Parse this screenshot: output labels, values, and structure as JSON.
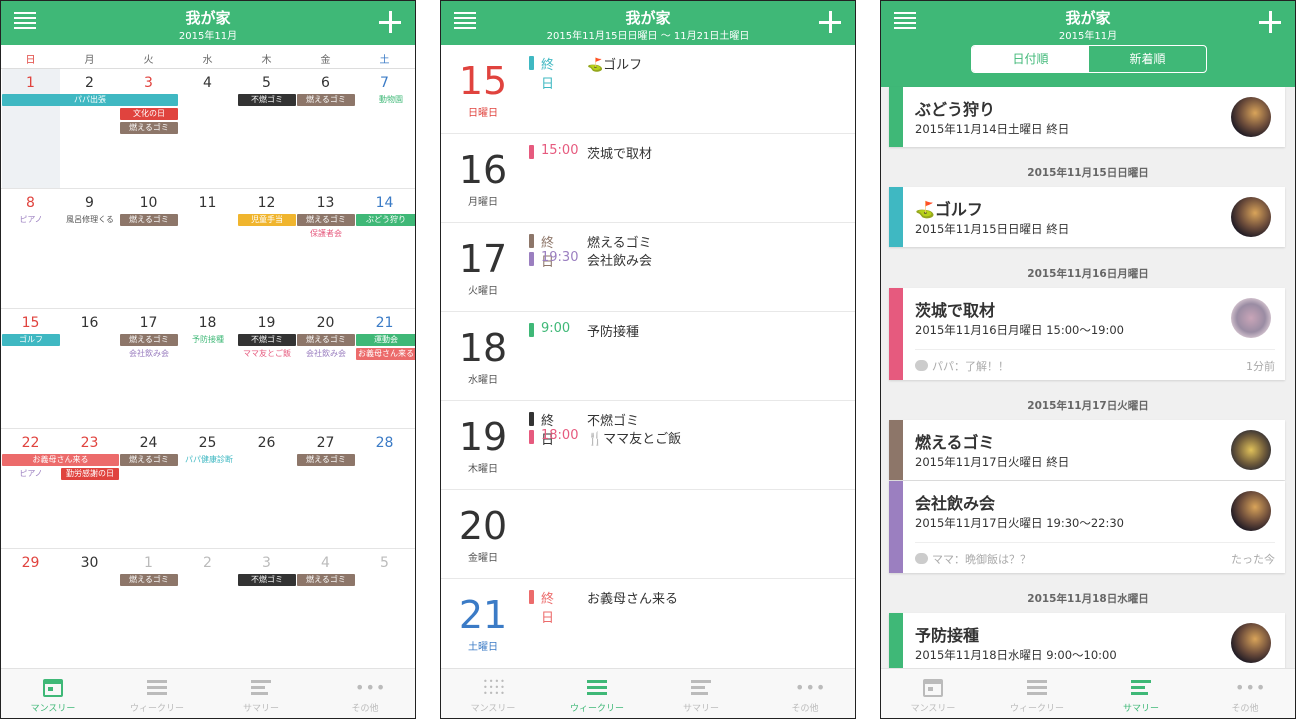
{
  "colors": {
    "green": "#3fb877",
    "teal": "#3fb8c2",
    "red": "#e0433e",
    "brown": "#8d7669",
    "black": "#333333",
    "yellow": "#f0b52e",
    "pink": "#e65a7e",
    "purple": "#9b7fc0",
    "salmon": "#ec6b6b",
    "blue": "#3b7bc6"
  },
  "monthly": {
    "title": "我が家",
    "subtitle": "2015年11月",
    "dow": [
      "日",
      "月",
      "火",
      "水",
      "木",
      "金",
      "土"
    ],
    "weeks": [
      {
        "days": [
          "1",
          "2",
          "3",
          "4",
          "5",
          "6",
          "7"
        ]
      },
      {
        "days": [
          "8",
          "9",
          "10",
          "11",
          "12",
          "13",
          "14"
        ]
      },
      {
        "days": [
          "15",
          "16",
          "17",
          "18",
          "19",
          "20",
          "21"
        ]
      },
      {
        "days": [
          "22",
          "23",
          "24",
          "25",
          "26",
          "27",
          "28"
        ]
      },
      {
        "days": [
          "29",
          "30",
          "1",
          "2",
          "3",
          "4",
          "5"
        ]
      }
    ],
    "events": {
      "papa_trip": "パパ出張",
      "bunka": "文化の日",
      "moeru": "燃えるゴミ",
      "funen": "不燃ゴミ",
      "zoo": "動物園",
      "piano": "ピアノ",
      "furo": "風呂修理くる",
      "jido": "児童手当",
      "budou": "ぶどう狩り",
      "hogosha": "保護者会",
      "golf": "ゴルフ",
      "kaisha": "会社飲み会",
      "yobo": "予防接種",
      "mama": "ママ友とご飯",
      "undou": "運動会",
      "gibo": "お義母さん来る",
      "kinrou": "勤労感謝の日",
      "kenkou": "パパ健康診断"
    }
  },
  "weekly": {
    "title": "我が家",
    "subtitle": "2015年11月15日日曜日 〜 11月21日土曜日",
    "rows": [
      {
        "num": "15",
        "w": "日曜日",
        "items": [
          {
            "tm": "終日",
            "ti": "⛳ゴルフ"
          }
        ]
      },
      {
        "num": "16",
        "w": "月曜日",
        "items": [
          {
            "tm": "15:00",
            "ti": "茨城で取材"
          }
        ]
      },
      {
        "num": "17",
        "w": "火曜日",
        "items": [
          {
            "tm": "終日",
            "ti": "燃えるゴミ"
          },
          {
            "tm": "19:30",
            "ti": "会社飲み会"
          }
        ]
      },
      {
        "num": "18",
        "w": "水曜日",
        "items": [
          {
            "tm": "9:00",
            "ti": "予防接種"
          }
        ]
      },
      {
        "num": "19",
        "w": "木曜日",
        "items": [
          {
            "tm": "終日",
            "ti": "不燃ゴミ"
          },
          {
            "tm": "18:00",
            "ti": "🍴ママ友とご飯"
          }
        ]
      },
      {
        "num": "20",
        "w": "金曜日",
        "items": []
      },
      {
        "num": "21",
        "w": "土曜日",
        "items": [
          {
            "tm": "終日",
            "ti": "お義母さん来る"
          }
        ]
      }
    ]
  },
  "summary": {
    "title": "我が家",
    "subtitle": "2015年11月",
    "seg_a": "日付順",
    "seg_b": "新着順",
    "cards": [
      {
        "title": "ぶどう狩り",
        "sub": "2015年11月14日土曜日 終日"
      },
      {
        "sep": "2015年11月15日日曜日"
      },
      {
        "title": "⛳ゴルフ",
        "sub": "2015年11月15日日曜日 終日"
      },
      {
        "sep": "2015年11月16日月曜日"
      },
      {
        "title": "茨城で取材",
        "sub": "2015年11月16日月曜日 15:00〜19:00",
        "comment": "パパ：了解！！",
        "ago": "1分前"
      },
      {
        "sep": "2015年11月17日火曜日"
      },
      {
        "title": "燃えるゴミ",
        "sub": "2015年11月17日火曜日 終日"
      },
      {
        "title": "会社飲み会",
        "sub": "2015年11月17日火曜日 19:30〜22:30",
        "comment": "ママ：晩御飯は？？",
        "ago": "たった今"
      },
      {
        "sep": "2015年11月18日水曜日"
      },
      {
        "title": "予防接種",
        "sub": "2015年11月18日水曜日 9:00〜10:00"
      }
    ]
  },
  "tabs": [
    "マンスリー",
    "ウィークリー",
    "サマリー",
    "その他"
  ]
}
